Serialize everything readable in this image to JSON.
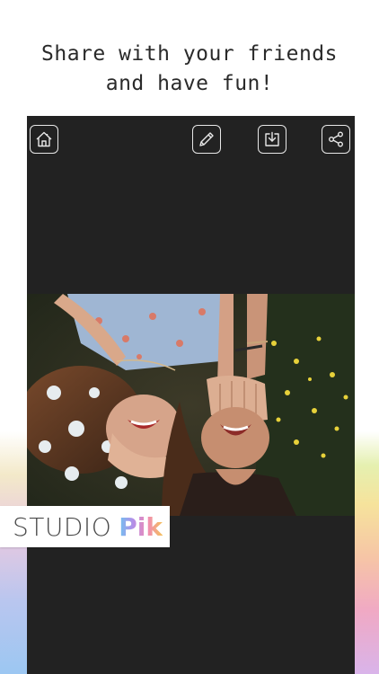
{
  "headline": {
    "line1": "Share with your friends",
    "line2": "and have fun!"
  },
  "toolbar": {
    "home_icon": "home-icon",
    "edit_icon": "pencil-icon",
    "save_icon": "download-icon",
    "share_icon": "share-icon"
  },
  "photo": {
    "subject": "two-friends-covering-eyes-photo"
  },
  "logo": {
    "studio": "STUDIO",
    "pik": "Pik"
  },
  "colors": {
    "screen_bg": "#222222",
    "icon_stroke": "#e8e8e8",
    "headline_text": "#2a2a2a"
  }
}
